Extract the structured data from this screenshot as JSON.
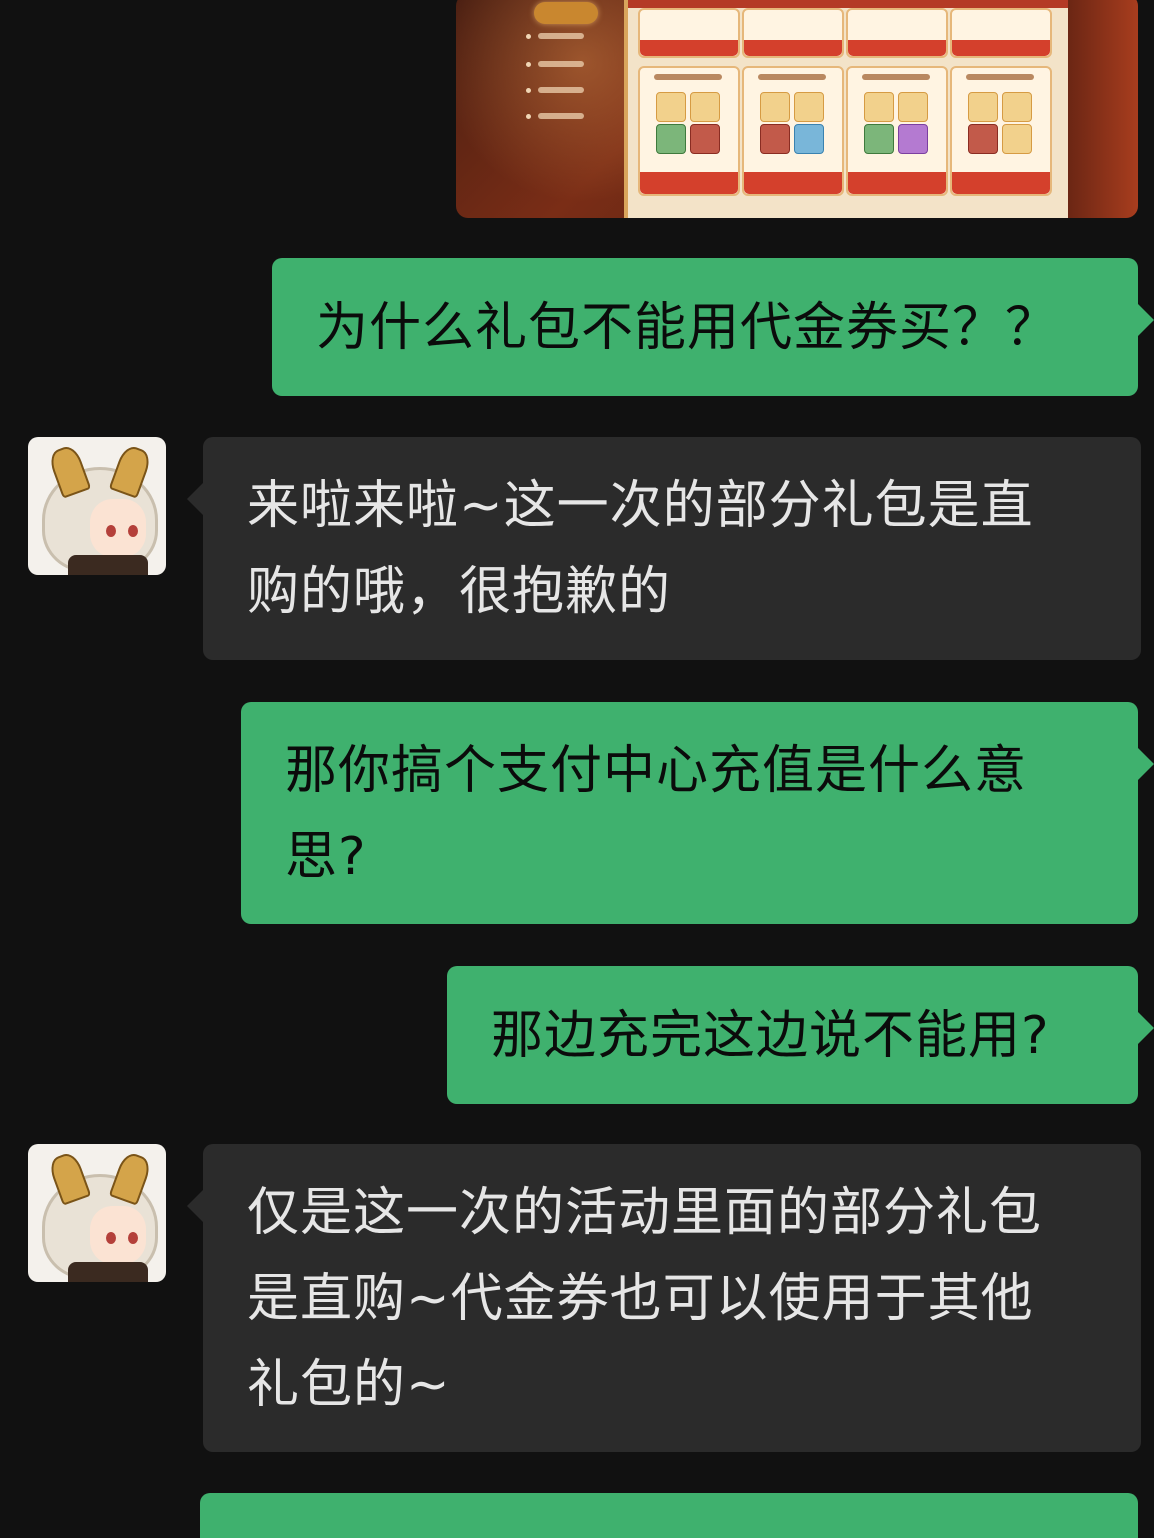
{
  "conversation": {
    "messages": [
      {
        "side": "sent",
        "type": "image",
        "label": "screenshot of gift packs"
      },
      {
        "side": "sent",
        "type": "text",
        "lines": [
          "为什么礼包不能用代金券买？？"
        ]
      },
      {
        "side": "recv",
        "type": "text",
        "lines": [
          "来啦来啦~这一次的部分礼包是直",
          "购的哦，很抱歉的"
        ]
      },
      {
        "side": "sent",
        "type": "text",
        "lines": [
          "那你搞个支付中心充值是什么意",
          "思?"
        ]
      },
      {
        "side": "sent",
        "type": "text",
        "lines": [
          "那边充完这边说不能用?"
        ]
      },
      {
        "side": "recv",
        "type": "text",
        "lines": [
          "仅是这一次的活动里面的部分礼包",
          "是直购~代金券也可以使用于其他",
          "礼包的~"
        ]
      },
      {
        "side": "sent",
        "type": "text",
        "lines": [
          ""
        ]
      }
    ]
  },
  "colors": {
    "background": "#111111",
    "sent_bubble": "#3fb16e",
    "received_bubble": "#2b2b2b",
    "received_text": "#e6e6e6",
    "sent_text": "#0b0b0b"
  },
  "icons": {
    "avatar": "support-agent-avatar-icon"
  }
}
